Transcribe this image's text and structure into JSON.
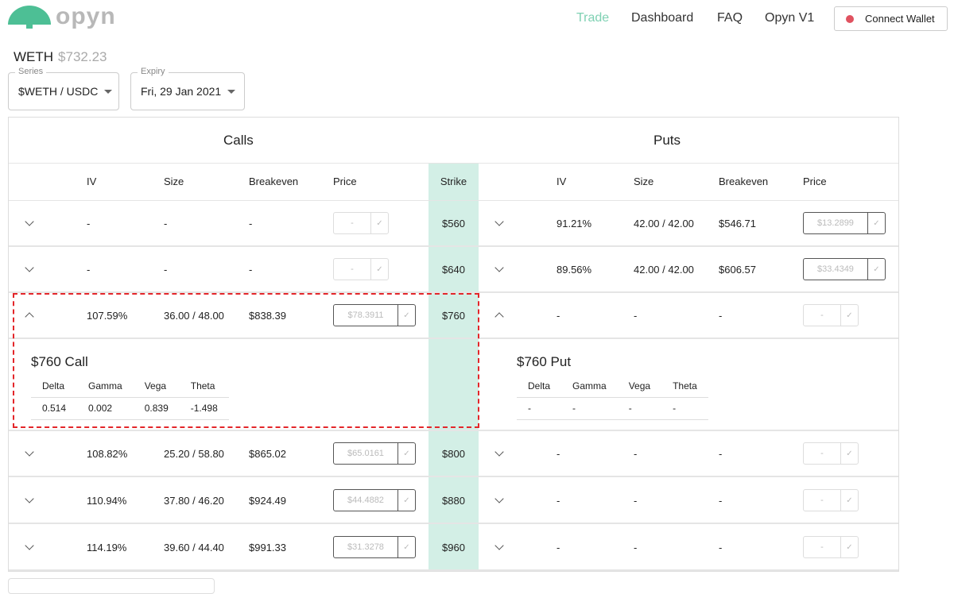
{
  "brand": {
    "name": "opyn",
    "color": "#4dbf95"
  },
  "nav": [
    {
      "label": "Trade",
      "active": true
    },
    {
      "label": "Dashboard"
    },
    {
      "label": "FAQ"
    },
    {
      "label": "Opyn V1"
    }
  ],
  "wallet": {
    "label": "Connect Wallet",
    "status_color": "#e05260"
  },
  "asset": {
    "name": "WETH",
    "price": "$732.23"
  },
  "series": {
    "label": "Series",
    "value": "$WETH / USDC"
  },
  "expiry": {
    "label": "Expiry",
    "value": "Fri, 29 Jan 2021"
  },
  "table": {
    "calls_title": "Calls",
    "puts_title": "Puts",
    "headers": {
      "iv": "IV",
      "size": "Size",
      "breakeven": "Breakeven",
      "price": "Price",
      "strike": "Strike"
    },
    "rows": [
      {
        "strike": "$560",
        "call": {
          "iv": "-",
          "size": "-",
          "breakeven": "-",
          "price": "-",
          "enabled": false
        },
        "put": {
          "iv": "91.21%",
          "size": "42.00 / 42.00",
          "breakeven": "$546.71",
          "price": "$13.2899",
          "enabled": true
        }
      },
      {
        "strike": "$640",
        "call": {
          "iv": "-",
          "size": "-",
          "breakeven": "-",
          "price": "-",
          "enabled": false
        },
        "put": {
          "iv": "89.56%",
          "size": "42.00 / 42.00",
          "breakeven": "$606.57",
          "price": "$33.4349",
          "enabled": true
        }
      },
      {
        "strike": "$760",
        "expanded": true,
        "call": {
          "iv": "107.59%",
          "size": "36.00 / 48.00",
          "breakeven": "$838.39",
          "price": "$78.3911",
          "enabled": true
        },
        "put": {
          "iv": "-",
          "size": "-",
          "breakeven": "-",
          "price": "-",
          "enabled": false
        }
      },
      {
        "strike": "$800",
        "call": {
          "iv": "108.82%",
          "size": "25.20 / 58.80",
          "breakeven": "$865.02",
          "price": "$65.0161",
          "enabled": true
        },
        "put": {
          "iv": "-",
          "size": "-",
          "breakeven": "-",
          "price": "-",
          "enabled": false
        }
      },
      {
        "strike": "$880",
        "call": {
          "iv": "110.94%",
          "size": "37.80 / 46.20",
          "breakeven": "$924.49",
          "price": "$44.4882",
          "enabled": true
        },
        "put": {
          "iv": "-",
          "size": "-",
          "breakeven": "-",
          "price": "-",
          "enabled": false
        }
      },
      {
        "strike": "$960",
        "call": {
          "iv": "114.19%",
          "size": "39.60 / 44.40",
          "breakeven": "$991.33",
          "price": "$31.3278",
          "enabled": true
        },
        "put": {
          "iv": "-",
          "size": "-",
          "breakeven": "-",
          "price": "-",
          "enabled": false
        }
      }
    ],
    "greeks_headers": [
      "Delta",
      "Gamma",
      "Vega",
      "Theta"
    ],
    "expanded": {
      "call": {
        "title": "$760 Call",
        "values": [
          "0.514",
          "0.002",
          "0.839",
          "-1.498"
        ]
      },
      "put": {
        "title": "$760 Put",
        "values": [
          "-",
          "-",
          "-",
          "-"
        ]
      }
    }
  },
  "colors": {
    "accent": "#4dbf95",
    "strike_bg": "#d3efe6",
    "highlight": "#e3262a"
  }
}
